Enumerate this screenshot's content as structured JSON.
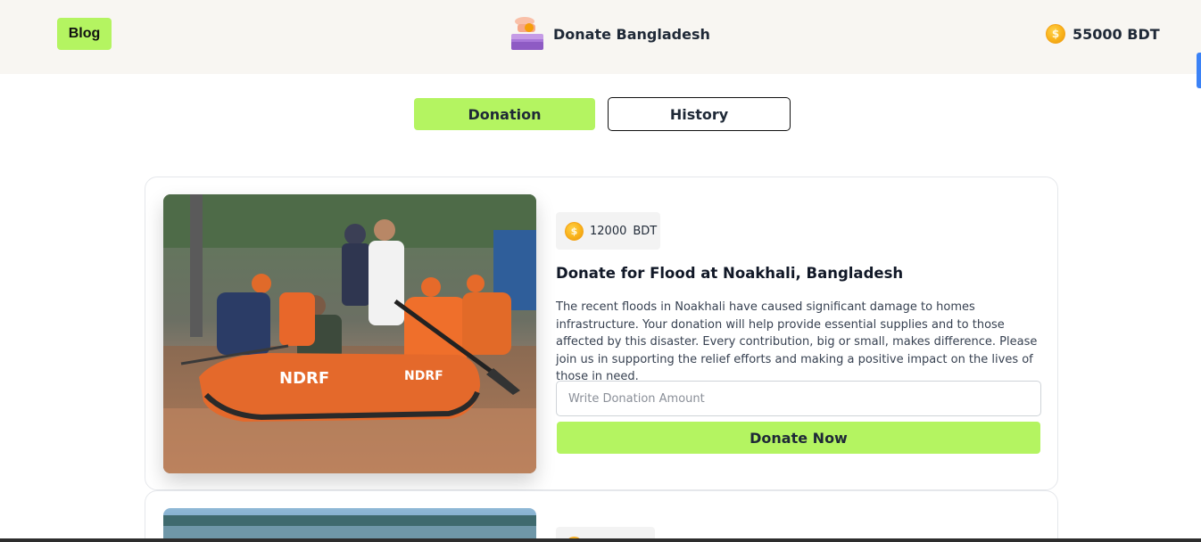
{
  "header": {
    "blog_label": "Blog",
    "site_title": "Donate Bangladesh",
    "balance_amount": "55000",
    "balance_currency": "BDT"
  },
  "tabs": [
    {
      "label": "Donation",
      "active": true
    },
    {
      "label": "History",
      "active": false
    }
  ],
  "cards": [
    {
      "amount": "12000",
      "currency": "BDT",
      "title": "Donate for Flood at Noakhali, Bangladesh",
      "description": "The recent floods in Noakhali have caused significant damage to homes infrastructure. Your donation will help provide essential supplies and to those affected by this disaster. Every contribution, big or small, makes difference. Please join us in supporting the relief efforts and making a positive impact on the lives of those in need.",
      "input_placeholder": "Write Donation Amount",
      "button_label": "Donate Now"
    }
  ],
  "colors": {
    "accent": "#b4f461",
    "header_bg": "#f8f6f2",
    "coin": "#f9b21a"
  }
}
